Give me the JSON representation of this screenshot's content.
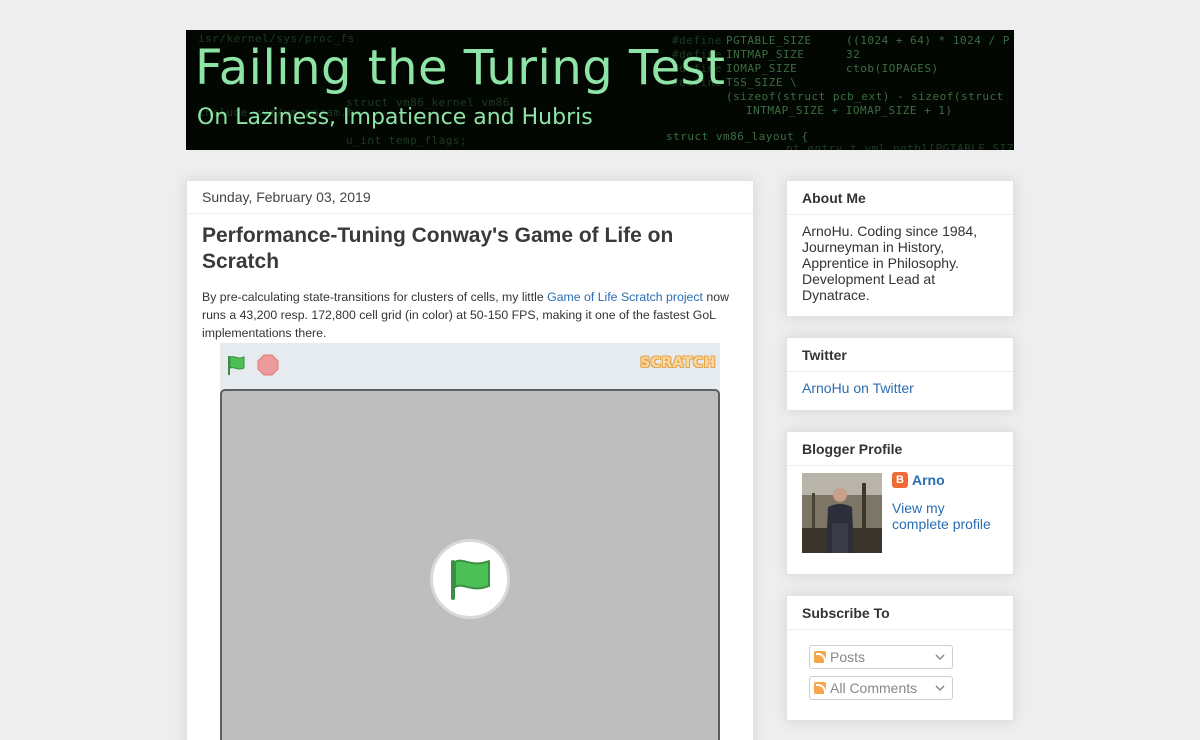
{
  "header": {
    "title": "Failing the Turing Test",
    "subtitle": "On Laziness, Impatience and Hubris"
  },
  "post": {
    "date": "Sunday, February 03, 2019",
    "title": "Performance-Tuning Conway's Game of Life on Scratch",
    "body_before": "By pre-calculating state-transitions for clusters of cells, my little ",
    "body_link": "Game of Life Scratch project",
    "body_after": " now runs a 43,200 resp. 172,800 cell grid (in color) at 50-150 FPS, making it one of the fastest GoL implementations there.",
    "scratch": {
      "logo": "SCRATCH",
      "green_flag_color": "#4cbf56",
      "stop_color": "#ec5959"
    }
  },
  "sidebar": {
    "about": {
      "title": "About Me",
      "text": "ArnoHu. Coding since 1984, Journeyman in History, Apprentice in Philosophy. Development Lead at Dynatrace."
    },
    "twitter": {
      "title": "Twitter",
      "link": "ArnoHu on Twitter"
    },
    "profile": {
      "title": "Blogger Profile",
      "name": "Arno",
      "link": "View my complete profile"
    },
    "subscribe": {
      "title": "Subscribe To",
      "posts": "Posts",
      "comments": "All Comments"
    }
  },
  "colors": {
    "header_text": "#8ee4a6",
    "link": "#2a6db3",
    "background": "#eeeeee"
  }
}
